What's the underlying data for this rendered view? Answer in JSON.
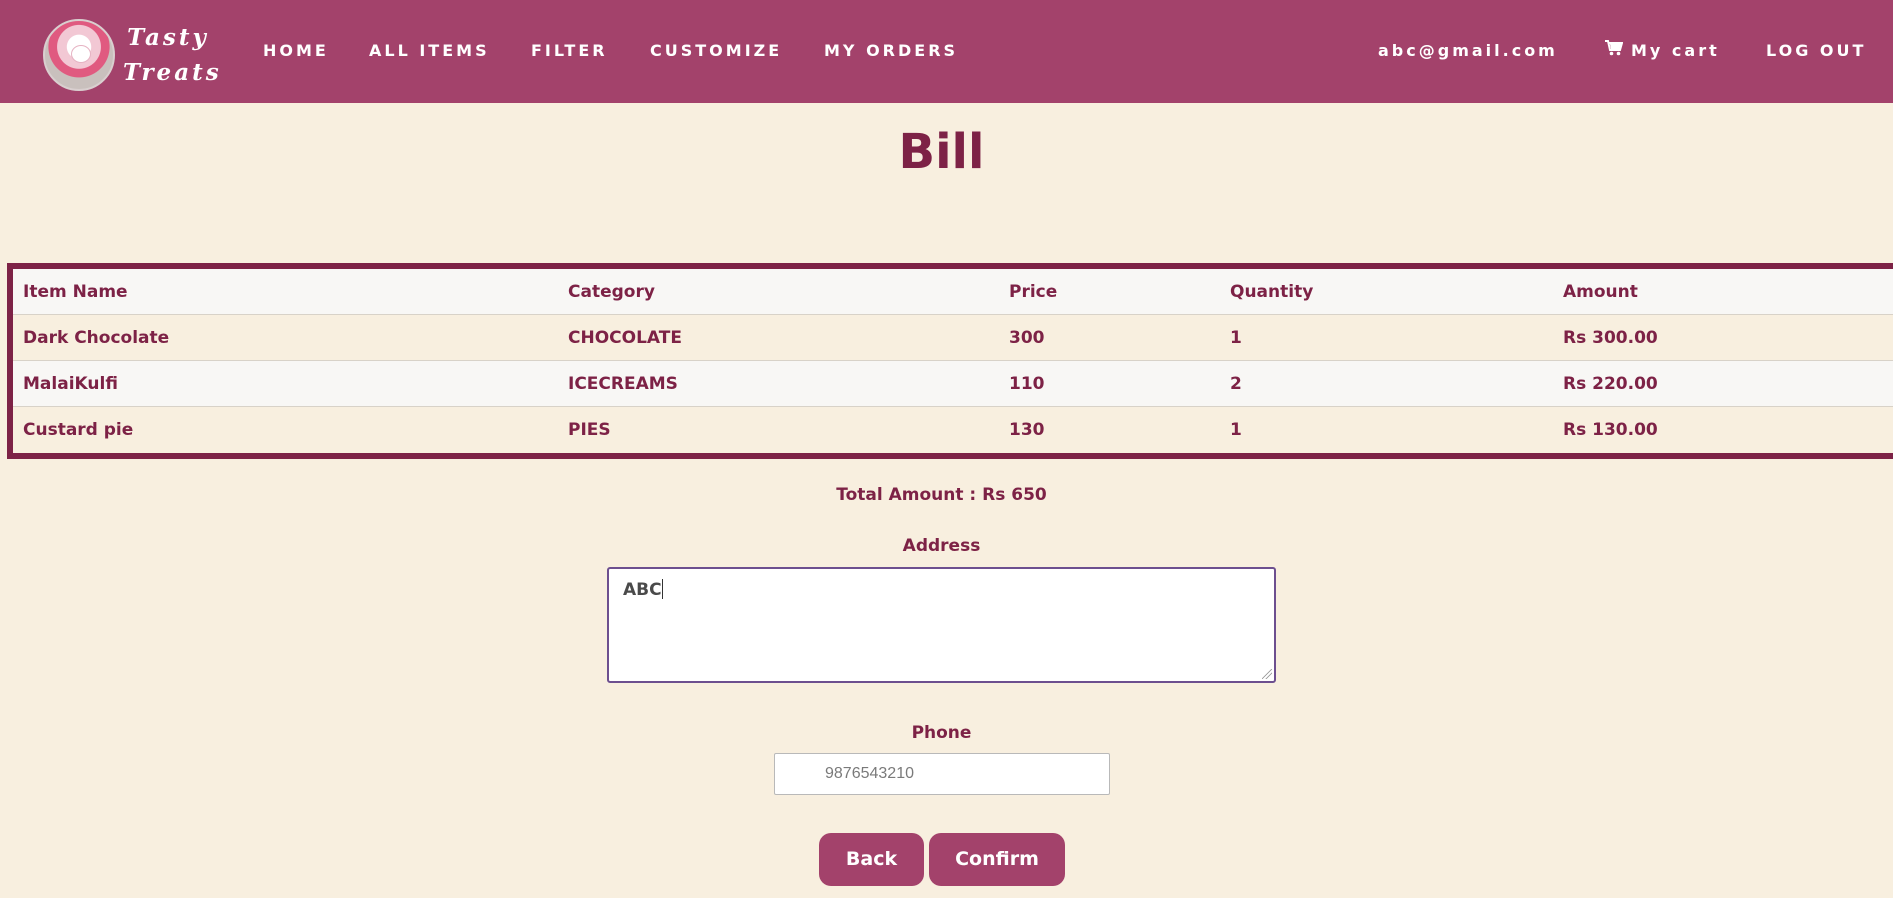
{
  "brand": {
    "line1": "Tasty",
    "line2": "Treats",
    "logo_icon": "cake-logo"
  },
  "nav": {
    "home": "HOME",
    "all_items": "ALL ITEMS",
    "filter": "FILTER",
    "customize": "CUSTOMIZE",
    "my_orders": "MY ORDERS",
    "user_email": "abc@gmail.com",
    "cart_icon": "shopping-cart-icon",
    "my_cart": "My cart",
    "log_out": "LOG OUT"
  },
  "page_title": "Bill",
  "table": {
    "headers": [
      "Item Name",
      "Category",
      "Price",
      "Quantity",
      "Amount"
    ],
    "rows": [
      [
        "Dark Chocolate",
        "CHOCOLATE",
        "300",
        "1",
        "Rs 300.00"
      ],
      [
        "MalaiKulfi",
        "ICECREAMS",
        "110",
        "2",
        "Rs 220.00"
      ],
      [
        "Custard pie",
        "PIES",
        "130",
        "1",
        "Rs 130.00"
      ]
    ]
  },
  "total": "Total Amount : Rs 650",
  "address": {
    "label": "Address",
    "value": "ABC"
  },
  "phone": {
    "label": "Phone",
    "placeholder": "9876543210"
  },
  "buttons": {
    "back": "Back",
    "confirm": "Confirm"
  },
  "colors": {
    "nav_bg": "#a3426b",
    "page_bg": "#f8efdf",
    "text_primary": "#7d2246"
  }
}
